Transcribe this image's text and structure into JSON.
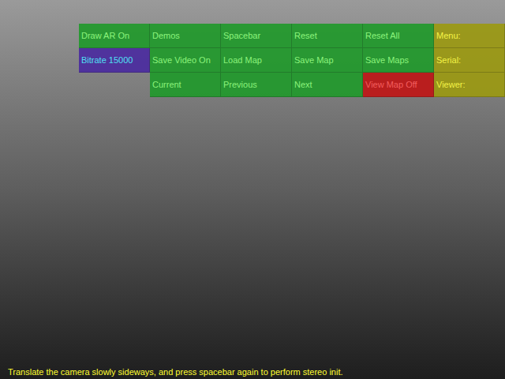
{
  "menu": {
    "rows": [
      [
        {
          "label": "Draw AR On",
          "kind": "button",
          "color": "#1f9a2a"
        },
        {
          "label": "Demos",
          "kind": "button",
          "color": "#1f9a2a"
        },
        {
          "label": "Spacebar",
          "kind": "button",
          "color": "#1f9a2a"
        },
        {
          "label": "Reset",
          "kind": "button",
          "color": "#1f9a2a"
        },
        {
          "label": "Reset All",
          "kind": "button",
          "color": "#1f9a2a"
        },
        {
          "label": "Menu:",
          "kind": "label",
          "color": "#9c9a10"
        }
      ],
      [
        {
          "label": "Bitrate 15000",
          "kind": "button",
          "color": "#4a2aa0"
        },
        {
          "label": "Save Video On",
          "kind": "button",
          "color": "#1f9a2a"
        },
        {
          "label": "Load Map",
          "kind": "button",
          "color": "#1f9a2a"
        },
        {
          "label": "Save Map",
          "kind": "button",
          "color": "#1f9a2a"
        },
        {
          "label": "Save Maps",
          "kind": "button",
          "color": "#1f9a2a"
        },
        {
          "label": "Serial:",
          "kind": "label",
          "color": "#9c9a10"
        }
      ],
      [
        {
          "label": "",
          "kind": "empty",
          "color": "#000000"
        },
        {
          "label": "Current",
          "kind": "button",
          "color": "#1f9a2a"
        },
        {
          "label": "Previous",
          "kind": "button",
          "color": "#1f9a2a"
        },
        {
          "label": "Next",
          "kind": "button",
          "color": "#1f9a2a"
        },
        {
          "label": "View Map Off",
          "kind": "button",
          "color": "#c01414"
        },
        {
          "label": "Viewer:",
          "kind": "label",
          "color": "#9c9a10"
        }
      ]
    ]
  },
  "status_message": "Translate the camera slowly sideways, and press spacebar again to perform stereo init."
}
